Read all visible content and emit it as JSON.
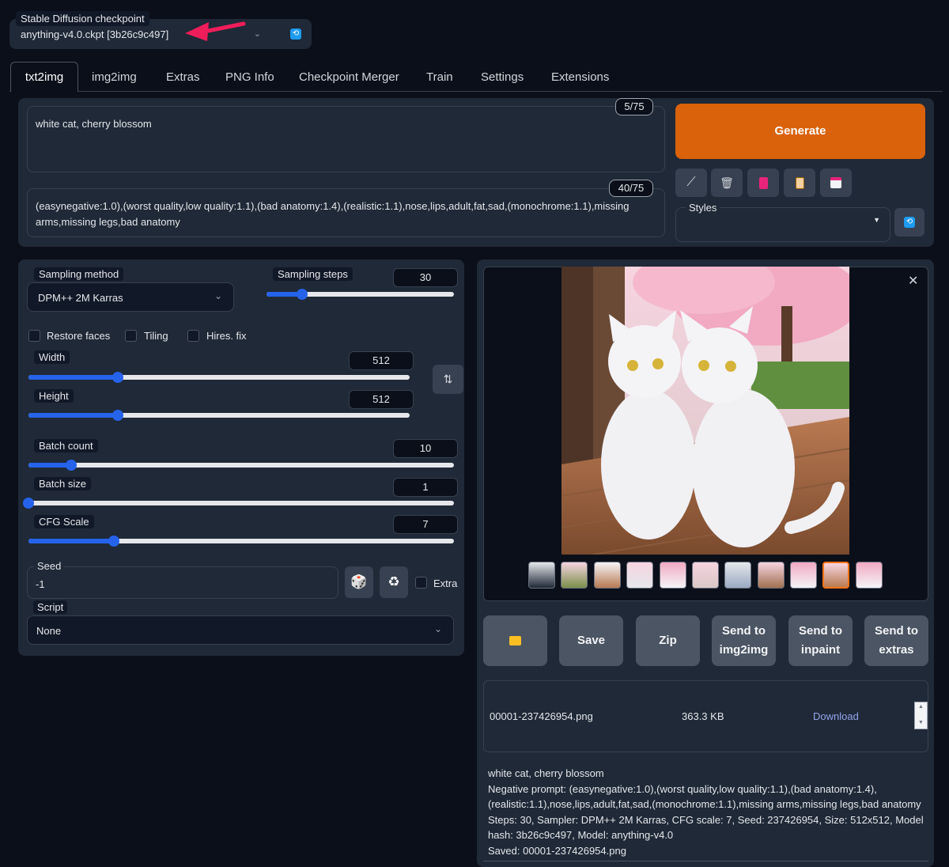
{
  "checkpoint": {
    "label": "Stable Diffusion checkpoint",
    "value": "anything-v4.0.ckpt [3b26c9c497]"
  },
  "tabs": [
    {
      "label": "txt2img",
      "active": true
    },
    {
      "label": "img2img"
    },
    {
      "label": "Extras"
    },
    {
      "label": "PNG Info"
    },
    {
      "label": "Checkpoint Merger"
    },
    {
      "label": "Train"
    },
    {
      "label": "Settings"
    },
    {
      "label": "Extensions"
    }
  ],
  "prompt": {
    "text": "white cat, cherry blossom",
    "counter": "5/75"
  },
  "negative_prompt": {
    "text": "(easynegative:1.0),(worst quality,low quality:1.1),(bad anatomy:1.4),(realistic:1.1),nose,lips,adult,fat,sad,(monochrome:1.1),missing arms,missing legs,bad anatomy",
    "counter": "40/75"
  },
  "generate_label": "Generate",
  "styles_label": "Styles",
  "sampling": {
    "method_label": "Sampling method",
    "method_value": "DPM++ 2M Karras",
    "steps_label": "Sampling steps",
    "steps_value": "30",
    "steps_fraction": 0.19
  },
  "checkboxes": {
    "restore_faces": "Restore faces",
    "tiling": "Tiling",
    "hires_fix": "Hires. fix"
  },
  "width": {
    "label": "Width",
    "value": "512",
    "fraction": 0.235
  },
  "height": {
    "label": "Height",
    "value": "512",
    "fraction": 0.235
  },
  "batch_count": {
    "label": "Batch count",
    "value": "10",
    "fraction": 0.1
  },
  "batch_size": {
    "label": "Batch size",
    "value": "1",
    "fraction": 0.0
  },
  "cfg_scale": {
    "label": "CFG Scale",
    "value": "7",
    "fraction": 0.2
  },
  "seed": {
    "label": "Seed",
    "value": "-1",
    "extra_label": "Extra"
  },
  "script": {
    "label": "Script",
    "value": "None"
  },
  "actions": {
    "folder_icon": "folder-icon",
    "save": "Save",
    "zip": "Zip",
    "send_img2img": "Send to img2img",
    "send_inpaint": "Send to inpaint",
    "send_extras": "Send to extras"
  },
  "file": {
    "name": "00001-237426954.png",
    "size": "363.3 KB",
    "download": "Download"
  },
  "info": {
    "prompt": "white cat, cherry blossom",
    "line1": "Negative prompt: (easynegative:1.0),(worst quality,low quality:1.1),(bad anatomy:1.4),",
    "line2": "(realistic:1.1),nose,lips,adult,fat,sad,(monochrome:1.1),missing arms,missing legs,bad anatomy",
    "line3": "Steps: 30, Sampler: DPM++ 2M Karras, CFG scale: 7, Seed: 237426954, Size: 512x512, Model",
    "line4": "hash: 3b26c9c497, Model: anything-v4.0",
    "saved": "Saved: 00001-237426954.png"
  },
  "colors": {
    "accent": "#2563eb",
    "generate": "#d9620a",
    "arrow": "#ef1d5a"
  }
}
